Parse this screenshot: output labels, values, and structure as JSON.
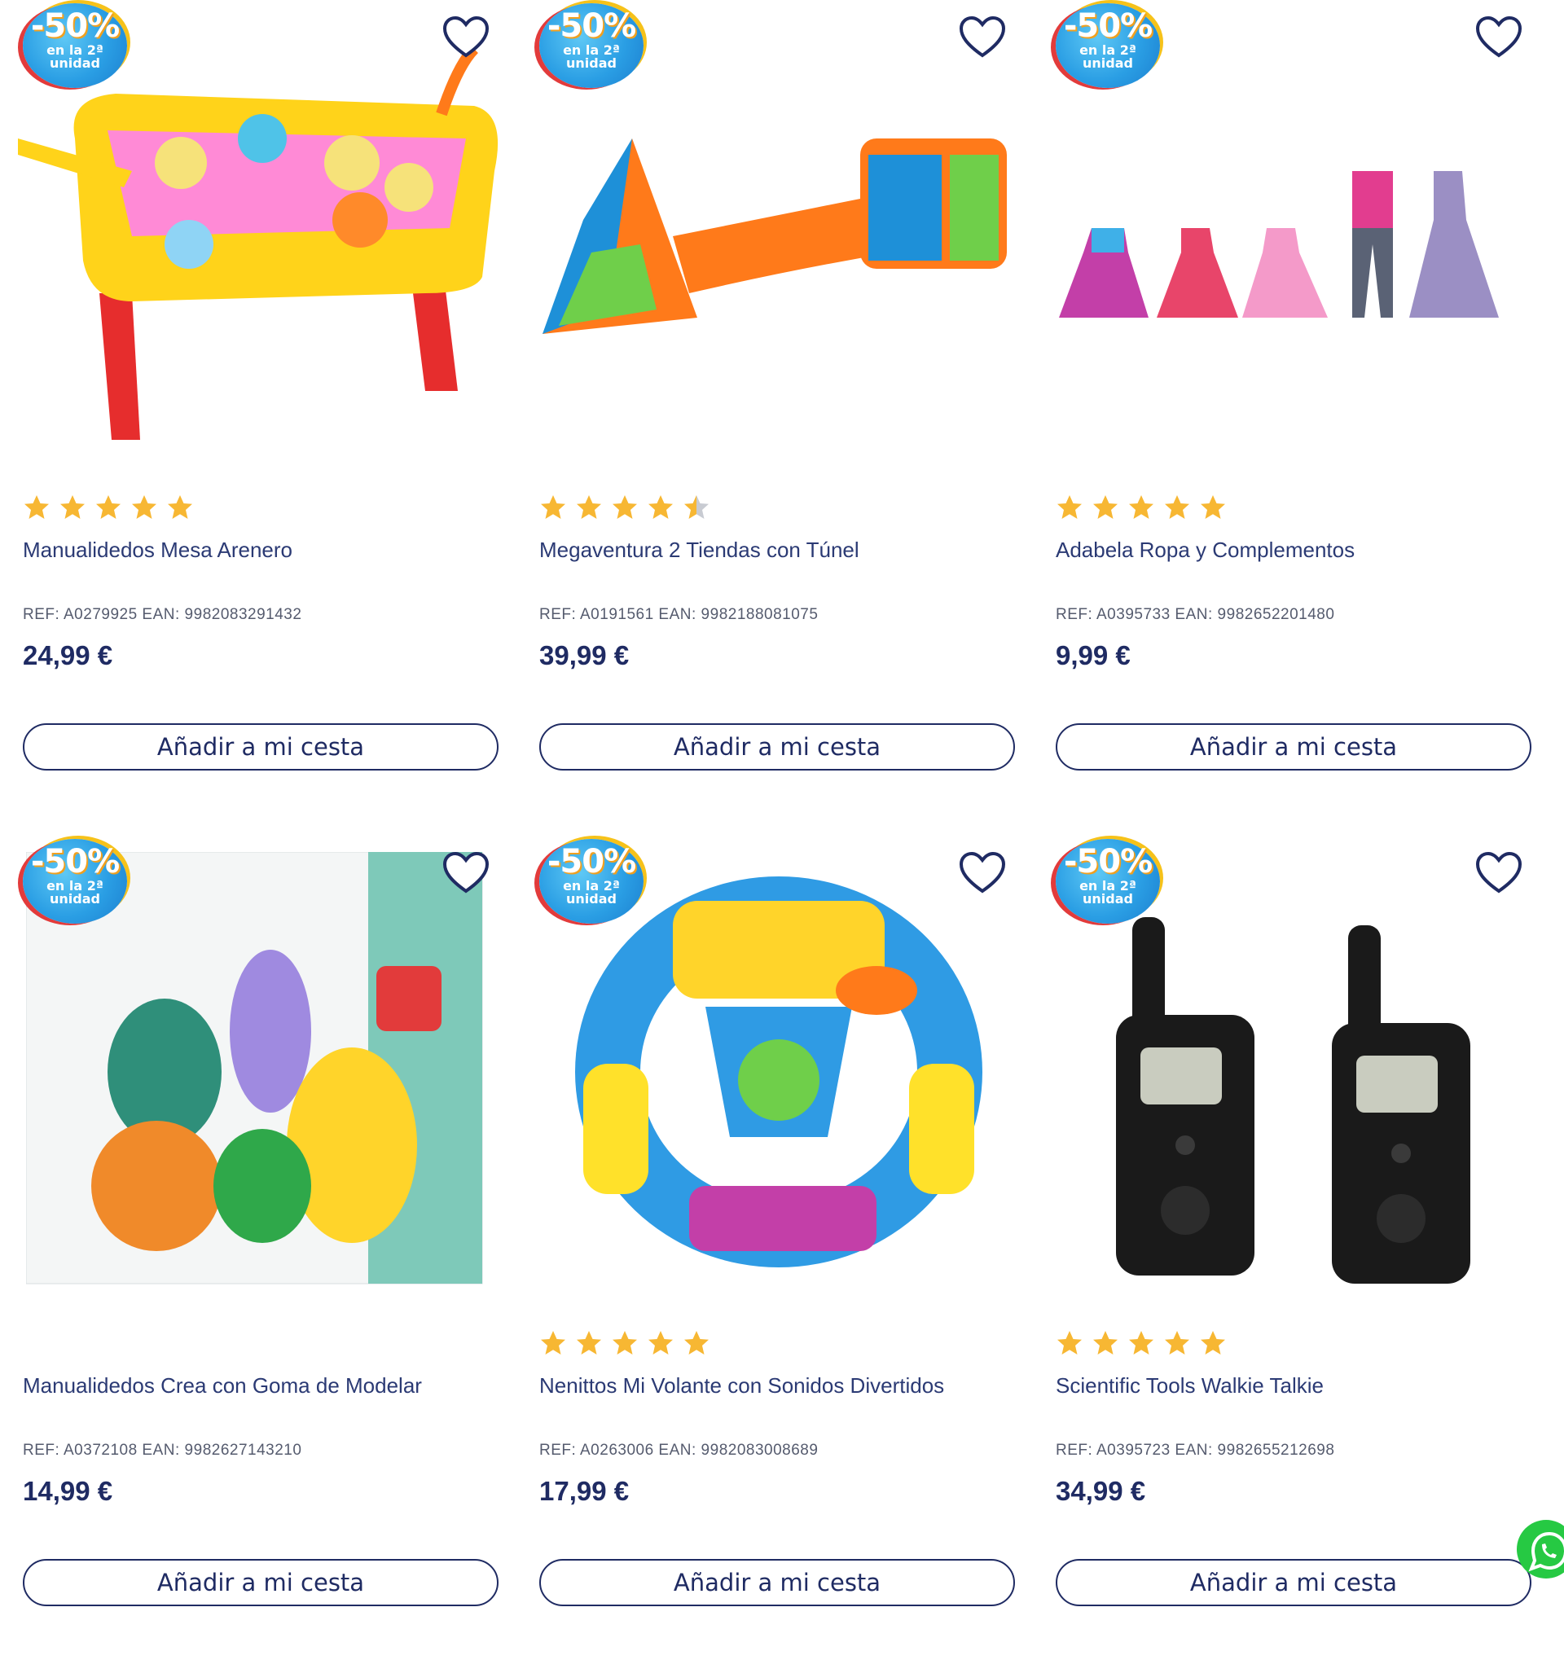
{
  "badge": {
    "percent": "-50%",
    "subtext": "en la 2ª unidad"
  },
  "colors": {
    "accent": "#1f2b63",
    "star": "#f7b733",
    "badge": "#2a9ee4",
    "whatsapp": "#26c943"
  },
  "products": [
    {
      "name": "Manualidedos Mesa Arenero",
      "ref": "REF: A0279925 EAN: 9982083291432",
      "price": "24,99 €",
      "rating": 5,
      "button": "Añadir a mi cesta",
      "has_stars": true
    },
    {
      "name": "Megaventura 2 Tiendas con Túnel",
      "ref": "REF: A0191561 EAN: 9982188081075",
      "price": "39,99 €",
      "rating": 4.5,
      "button": "Añadir a mi cesta",
      "has_stars": true
    },
    {
      "name": "Adabela Ropa y Complementos",
      "ref": "REF: A0395733 EAN: 9982652201480",
      "price": "9,99 €",
      "rating": 5,
      "button": "Añadir a mi cesta",
      "has_stars": true
    },
    {
      "name": "Manualidedos Crea con Goma de Modelar",
      "ref": "REF: A0372108 EAN: 9982627143210",
      "price": "14,99 €",
      "rating": 0,
      "button": "Añadir a mi cesta",
      "has_stars": false
    },
    {
      "name": "Nenittos Mi Volante con Sonidos Divertidos",
      "ref": "REF: A0263006 EAN: 9982083008689",
      "price": "17,99 €",
      "rating": 5,
      "button": "Añadir a mi cesta",
      "has_stars": true
    },
    {
      "name": "Scientific Tools Walkie Talkie",
      "ref": "REF: A0395723 EAN: 9982655212698",
      "price": "34,99 €",
      "rating": 5,
      "button": "Añadir a mi cesta",
      "has_stars": true
    }
  ],
  "icons": {
    "favorite": "heart-icon",
    "rating": "star-icon",
    "chat": "whatsapp-icon"
  }
}
